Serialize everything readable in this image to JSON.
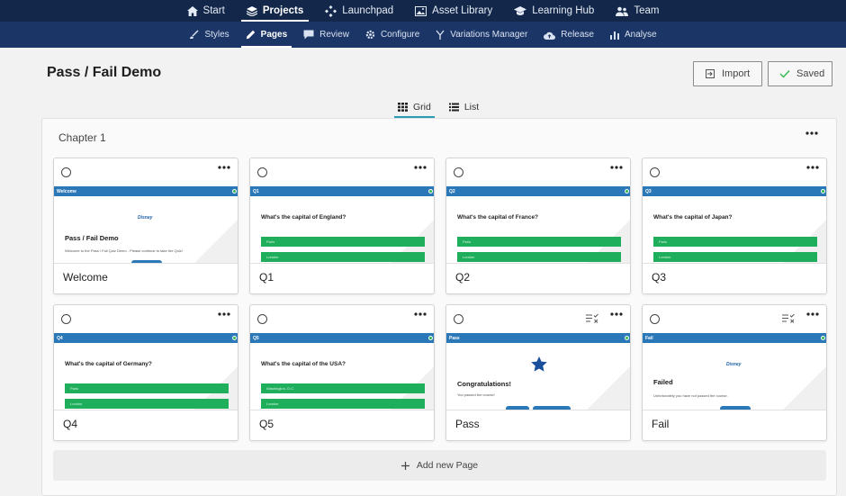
{
  "topnav": {
    "items": [
      {
        "label": "Start",
        "icon": "home-icon"
      },
      {
        "label": "Projects",
        "icon": "layers-icon",
        "active": true
      },
      {
        "label": "Launchpad",
        "icon": "launchpad-icon"
      },
      {
        "label": "Asset Library",
        "icon": "image-icon"
      },
      {
        "label": "Learning Hub",
        "icon": "graduation-cap-icon"
      },
      {
        "label": "Team",
        "icon": "team-icon"
      }
    ]
  },
  "subnav": {
    "items": [
      {
        "label": "Styles",
        "icon": "brush-icon"
      },
      {
        "label": "Pages",
        "icon": "pencil-icon",
        "active": true
      },
      {
        "label": "Review",
        "icon": "comment-icon"
      },
      {
        "label": "Configure",
        "icon": "gear-icon"
      },
      {
        "label": "Variations Manager",
        "icon": "branch-icon"
      },
      {
        "label": "Release",
        "icon": "cloud-upload-icon"
      },
      {
        "label": "Analyse",
        "icon": "bar-chart-icon"
      }
    ]
  },
  "page": {
    "title": "Pass / Fail Demo",
    "import_label": "Import",
    "saved_label": "Saved"
  },
  "view": {
    "grid_label": "Grid",
    "list_label": "List",
    "active": "Grid"
  },
  "chapter": {
    "title": "Chapter 1",
    "add_page_label": "Add new Page"
  },
  "cards": [
    {
      "name": "Welcome",
      "header": "Welcome",
      "type": "intro",
      "title": "Pass / Fail Demo",
      "text": "Welcome to the Pass / Fail Quiz Demo - Please continue to take the Quiz!",
      "logo": "Disney"
    },
    {
      "name": "Q1",
      "header": "Q1",
      "type": "question",
      "question": "What's the capital of England?",
      "answers": [
        "Paris",
        "London"
      ]
    },
    {
      "name": "Q2",
      "header": "Q2",
      "type": "question",
      "question": "What's the capital of France?",
      "answers": [
        "Paris",
        "London"
      ]
    },
    {
      "name": "Q3",
      "header": "Q3",
      "type": "question",
      "question": "What's the capital of Japan?",
      "answers": [
        "Paris",
        "London"
      ]
    },
    {
      "name": "Q4",
      "header": "Q4",
      "type": "question",
      "question": "What's the capital of Germany?",
      "answers": [
        "Paris",
        "London"
      ]
    },
    {
      "name": "Q5",
      "header": "Q5",
      "type": "question",
      "question": "What's the capital of the USA?",
      "answers": [
        "Washington, D.C.",
        "London"
      ]
    },
    {
      "name": "Pass",
      "header": "Pass",
      "type": "result",
      "title": "Congratulations!",
      "text": "You passed the course!",
      "flag": true
    },
    {
      "name": "Fail",
      "header": "Fail",
      "type": "result-fail",
      "title": "Failed",
      "text": "Unfortunately you have not passed the course.",
      "logo": "Disney",
      "flag": true
    }
  ],
  "colors": {
    "topnav_bg": "#13274a",
    "subnav_bg": "#1b3566",
    "slide_header": "#2a78b8",
    "answer_green": "#1fae5c",
    "accent": "#2a9bb0"
  }
}
